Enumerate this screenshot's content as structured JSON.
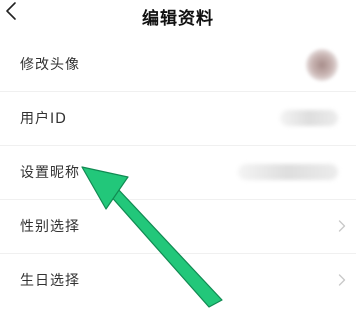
{
  "header": {
    "title": "编辑资料"
  },
  "rows": [
    {
      "label": "修改头像"
    },
    {
      "label": "用户ID"
    },
    {
      "label": "设置昵称"
    },
    {
      "label": "性别选择"
    },
    {
      "label": "生日选择"
    }
  ],
  "icons": {
    "back": "chevron-left-icon",
    "row_arrow": "chevron-right-icon",
    "annotation": "green-arrow"
  },
  "colors": {
    "annotation_arrow": "#22c77a",
    "annotation_arrow_stroke": "#118a52",
    "divider": "#f0f0f0",
    "chevron": "#c8c8c8"
  }
}
